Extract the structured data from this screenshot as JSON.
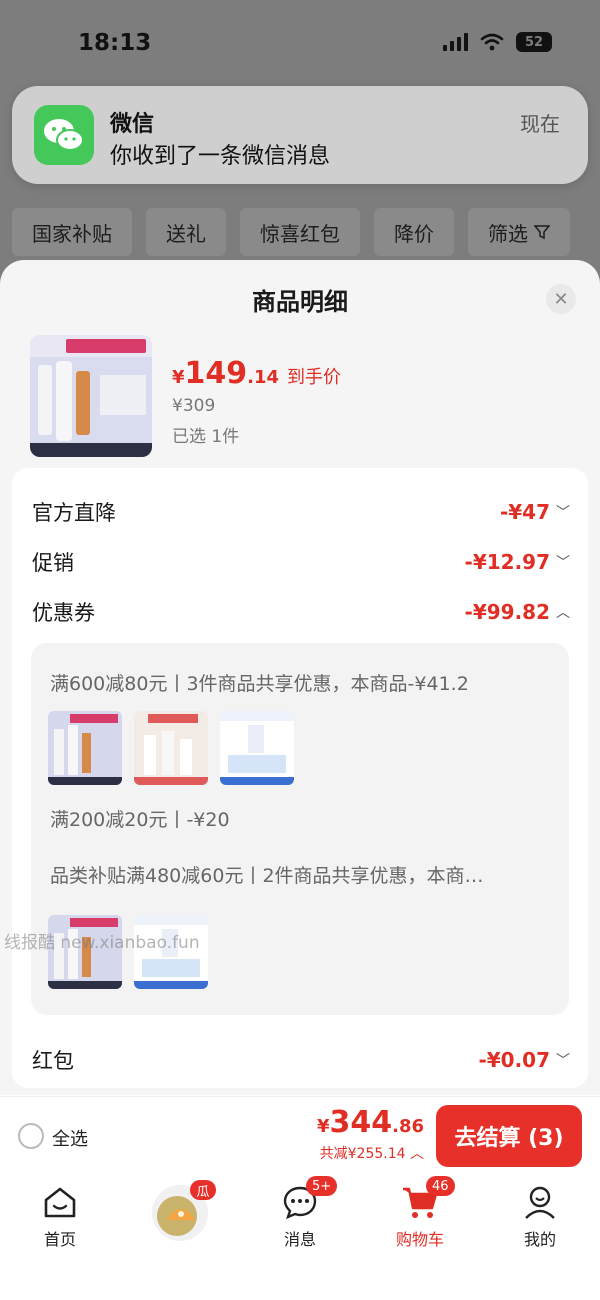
{
  "status_bar": {
    "time": "18:13",
    "battery": "52"
  },
  "notification": {
    "app": "微信",
    "message": "你收到了一条微信消息",
    "time": "现在"
  },
  "filters": [
    {
      "label": "国家补贴"
    },
    {
      "label": "送礼"
    },
    {
      "label": "惊喜红包"
    },
    {
      "label": "降价"
    },
    {
      "label": "筛选"
    }
  ],
  "sheet": {
    "title": "商品明细",
    "close_icon": "close-icon",
    "product": {
      "price_currency": "¥",
      "price_int": "149",
      "price_dec": ".14",
      "price_suffix": "到手价",
      "original_price": "¥309",
      "selected": "已选 1件"
    },
    "rows": {
      "official_cut": {
        "label": "官方直降",
        "value": "-¥47"
      },
      "promotion": {
        "label": "促销",
        "value": "-¥12.97"
      },
      "coupon": {
        "label": "优惠券",
        "value": "-¥99.82"
      },
      "red_packet": {
        "label": "红包",
        "value": "-¥0.07"
      }
    },
    "coupon_details": {
      "line1": "满600减80元丨3件商品共享优惠，本商品-¥41.2",
      "line2": "满200减20元丨-¥20",
      "line3": "品类补贴满480减60元丨2件商品共享优惠，本商…"
    }
  },
  "watermark": "线报酷 new.xianbao.fun",
  "bottom_bar": {
    "select_all": "全选",
    "total_currency": "¥",
    "total_int": "344",
    "total_dec": ".86",
    "total_saved": "共减¥255.14",
    "checkout": "去结算 (3)"
  },
  "tab_bar": {
    "home": "首页",
    "messages": "消息",
    "messages_badge": "5+",
    "cart": "购物车",
    "cart_badge": "46",
    "mine": "我的",
    "promo_badge": "瓜"
  },
  "colors": {
    "accent": "#e02e24",
    "wechat_green": "#44c85a"
  }
}
